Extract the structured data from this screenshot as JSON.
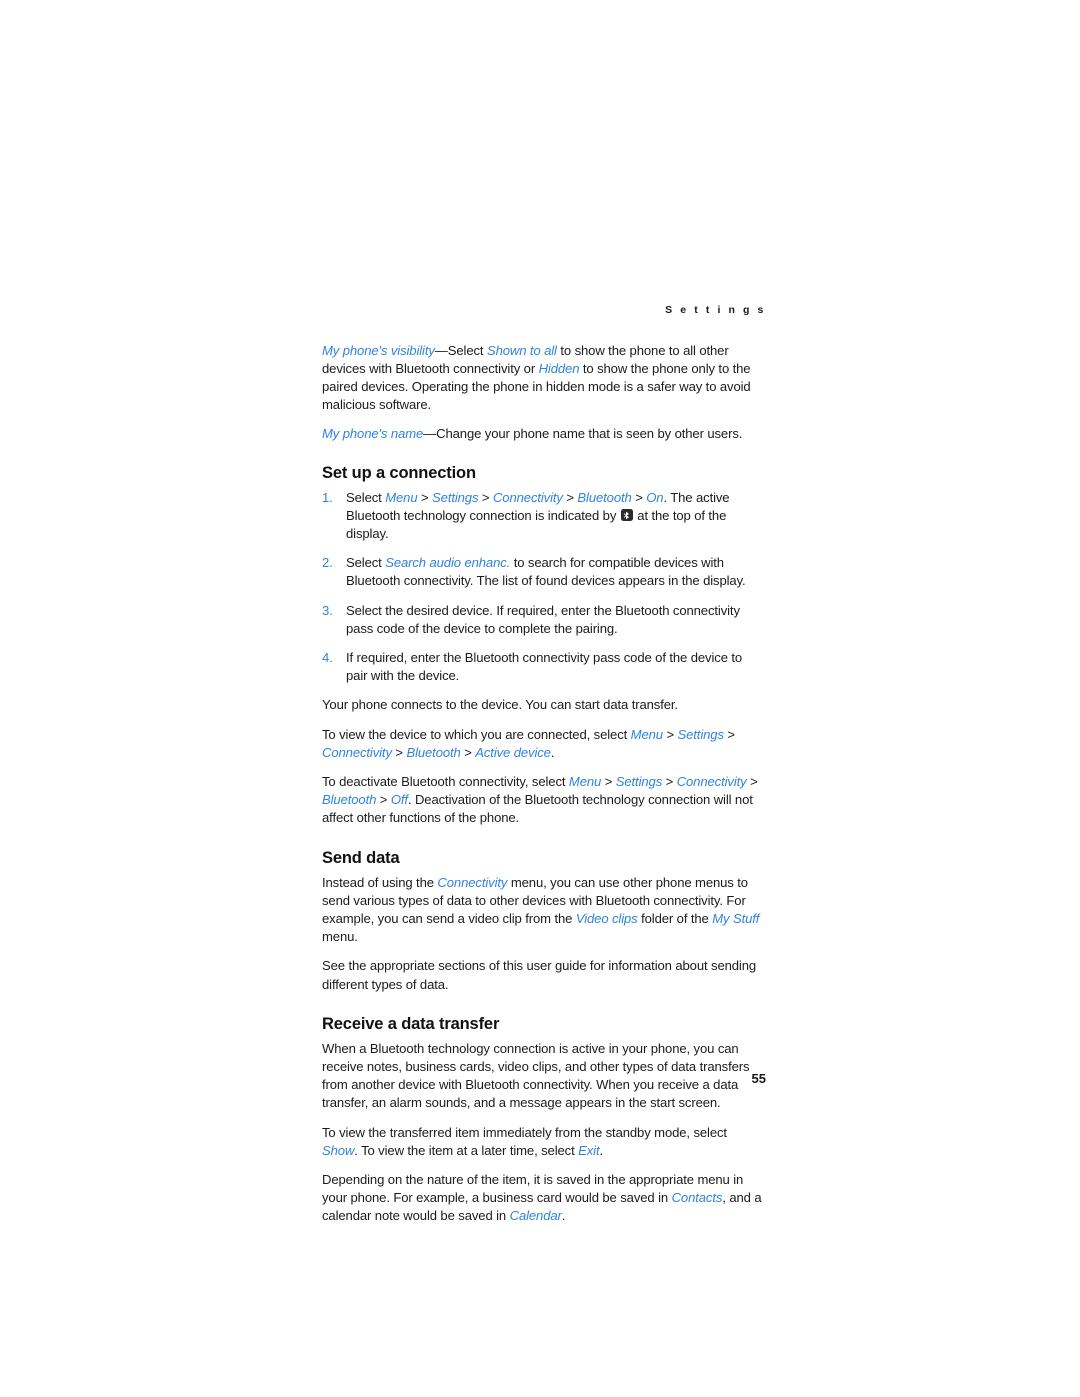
{
  "document": {
    "running_head": "S e t t i n g s",
    "page_number": "55",
    "accent_color": "#2f83e0",
    "text_color": "#1c1c1c",
    "background_color": "#ffffff"
  },
  "intro": {
    "visibility_term": "My phone's visibility",
    "visibility_dash": "—Select ",
    "visibility_option_1": "Shown to all",
    "visibility_text_1": " to show the phone to all other devices with Bluetooth connectivity or ",
    "visibility_option_2": "Hidden",
    "visibility_text_2": " to show the phone only to the paired devices. Operating the phone in hidden mode is a safer way to avoid malicious software.",
    "name_term": "My phone's name",
    "name_text": "—Change your phone name that is seen by other users."
  },
  "set_up_connection": {
    "heading": "Set up a connection",
    "steps": [
      {
        "number": "1.",
        "lead": "Select ",
        "path": [
          "Menu",
          "Settings",
          "Connectivity",
          "Bluetooth",
          "On"
        ],
        "separator": " > ",
        "after_path": ". The active Bluetooth technology connection is indicated by ",
        "icon": "bluetooth-icon",
        "tail": " at the top of the display."
      },
      {
        "number": "2.",
        "lead": "Select ",
        "link": "Search audio enhanc.",
        "tail": " to search for compatible devices with Bluetooth connectivity. The list of found devices appears in the display."
      },
      {
        "number": "3.",
        "text": "Select the desired device. If required, enter the Bluetooth connectivity pass code of the device to complete the pairing."
      },
      {
        "number": "4.",
        "text": "If required, enter the Bluetooth connectivity pass code of the device to pair with the device."
      }
    ],
    "after_steps": "Your phone connects to the device. You can start data transfer.",
    "view_device_lead": "To view the device to which you are connected, select ",
    "view_device_path": [
      "Menu",
      "Settings",
      "Connectivity",
      "Bluetooth",
      "Active device"
    ],
    "view_device_tail": ".",
    "deactivate_lead": "To deactivate Bluetooth connectivity, select ",
    "deactivate_path": [
      "Menu",
      "Settings",
      "Connectivity",
      "Bluetooth",
      "Off"
    ],
    "deactivate_tail": ". Deactivation of the Bluetooth technology connection will not affect other functions of the phone."
  },
  "send_data": {
    "heading": "Send data",
    "para_1_a": "Instead of using the ",
    "para_1_link_1": "Connectivity",
    "para_1_b": " menu, you can use other phone menus to send various types of data to other devices with Bluetooth connectivity. For example, you can send a video clip from the ",
    "para_1_link_2": "Video clips",
    "para_1_c": " folder of the ",
    "para_1_link_3": "My Stuff",
    "para_1_d": " menu.",
    "para_2": "See the appropriate sections of this user guide for information about sending different types of data."
  },
  "receive_transfer": {
    "heading": "Receive a data transfer",
    "para_1": "When a Bluetooth technology connection is active in your phone, you can receive notes, business cards, video clips, and other types of data transfers from another device with Bluetooth connectivity. When you receive a data transfer, an alarm sounds, and a message appears in the start screen.",
    "para_2_a": "To view the transferred item immediately from the standby mode, select ",
    "para_2_link_1": "Show",
    "para_2_b": ". To view the item at a later time, select ",
    "para_2_link_2": "Exit",
    "para_2_c": ".",
    "para_3_a": "Depending on the nature of the item, it is saved in the appropriate menu in your phone. For example, a business card would be saved in ",
    "para_3_link_1": "Contacts",
    "para_3_b": ", and a calendar note would be saved in ",
    "para_3_link_2": "Calendar",
    "para_3_c": "."
  }
}
